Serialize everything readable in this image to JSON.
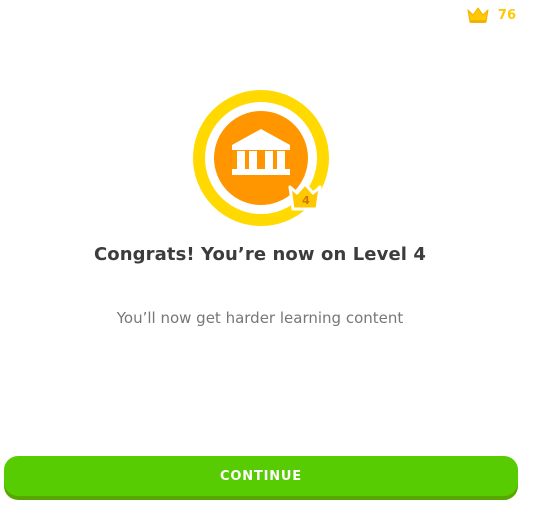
{
  "header": {
    "crown_icon": "crown-icon",
    "crown_count": "76"
  },
  "badge": {
    "icon": "building-columns-icon",
    "level_icon": "crown-icon",
    "level_number": "4"
  },
  "main": {
    "title": "Congrats! You’re now on Level 4",
    "subtitle": "You’ll now get harder learning content"
  },
  "footer": {
    "continue_label": "CONTINUE"
  },
  "colors": {
    "gold": "#ffc800",
    "orange": "#ff9600",
    "green": "#58cc02",
    "green_shadow": "#58a700",
    "title_text": "#3c3c3c",
    "subtitle_text": "#777777"
  }
}
